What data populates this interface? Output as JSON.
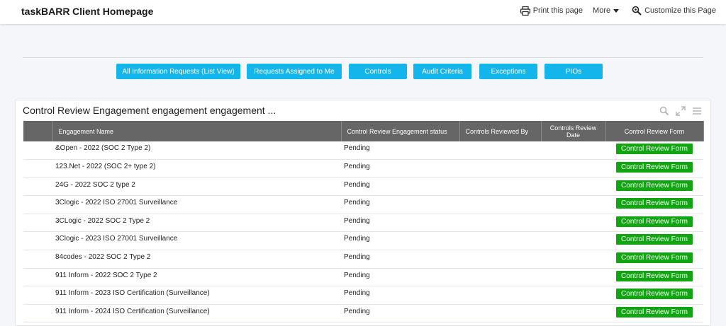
{
  "header": {
    "brand": "taskBARR",
    "separator": "›",
    "page_title": "Client Homepage",
    "actions": {
      "print": "Print this page",
      "more": "More",
      "customize": "Customize this Page"
    }
  },
  "nav_buttons": [
    {
      "label": "All Information Requests (List View)"
    },
    {
      "label": "Requests Assigned to Me"
    },
    {
      "label": "Controls"
    },
    {
      "label": "Audit Criteria"
    },
    {
      "label": "Exceptions"
    },
    {
      "label": "PIOs"
    }
  ],
  "report": {
    "title": "Control Review Engagement engagement engagement ...",
    "columns": [
      "",
      "Engagement Name",
      "Control Review Engagement status",
      "Controls Reviewed By",
      "Controls Review Date",
      "Control Review Form"
    ],
    "rows": [
      {
        "name": "&Open - 2022 (SOC 2 Type 2)",
        "status": "Pending",
        "reviewed_by": "",
        "review_date": "",
        "form": "Control Review Form"
      },
      {
        "name": "123.Net - 2022 (SOC 2+ type 2)",
        "status": "Pending",
        "reviewed_by": "",
        "review_date": "",
        "form": "Control Review Form"
      },
      {
        "name": "24G - 2022 SOC 2 type 2",
        "status": "Pending",
        "reviewed_by": "",
        "review_date": "",
        "form": "Control Review Form"
      },
      {
        "name": "3Clogic - 2022 ISO 27001 Surveillance",
        "status": "Pending",
        "reviewed_by": "",
        "review_date": "",
        "form": "Control Review Form"
      },
      {
        "name": "3CLogic - 2022 SOC 2 Type 2",
        "status": "Pending",
        "reviewed_by": "",
        "review_date": "",
        "form": "Control Review Form"
      },
      {
        "name": "3Clogic - 2023 ISO 27001 Surveillance",
        "status": "Pending",
        "reviewed_by": "",
        "review_date": "",
        "form": "Control Review Form"
      },
      {
        "name": "84codes - 2022 SOC 2 Type 2",
        "status": "Pending",
        "reviewed_by": "",
        "review_date": "",
        "form": "Control Review Form"
      },
      {
        "name": "911 Inform - 2022 SOC 2 Type 2",
        "status": "Pending",
        "reviewed_by": "",
        "review_date": "",
        "form": "Control Review Form"
      },
      {
        "name": "911 Inform - 2023 ISO Certification (Surveillance)",
        "status": "Pending",
        "reviewed_by": "",
        "review_date": "",
        "form": "Control Review Form"
      },
      {
        "name": "911 Inform - 2024 ISO Certification (Surveillance)",
        "status": "Pending",
        "reviewed_by": "",
        "review_date": "",
        "form": "Control Review Form"
      }
    ]
  },
  "colors": {
    "nav_button": "#14b5ea",
    "header_row": "#666666",
    "form_button": "#12a512"
  },
  "icons": {
    "print": "printer-icon",
    "more": "caret-down-icon",
    "customize": "magnifier-gear-icon",
    "search": "search-icon",
    "expand": "expand-icon",
    "menu": "hamburger-menu-icon"
  }
}
